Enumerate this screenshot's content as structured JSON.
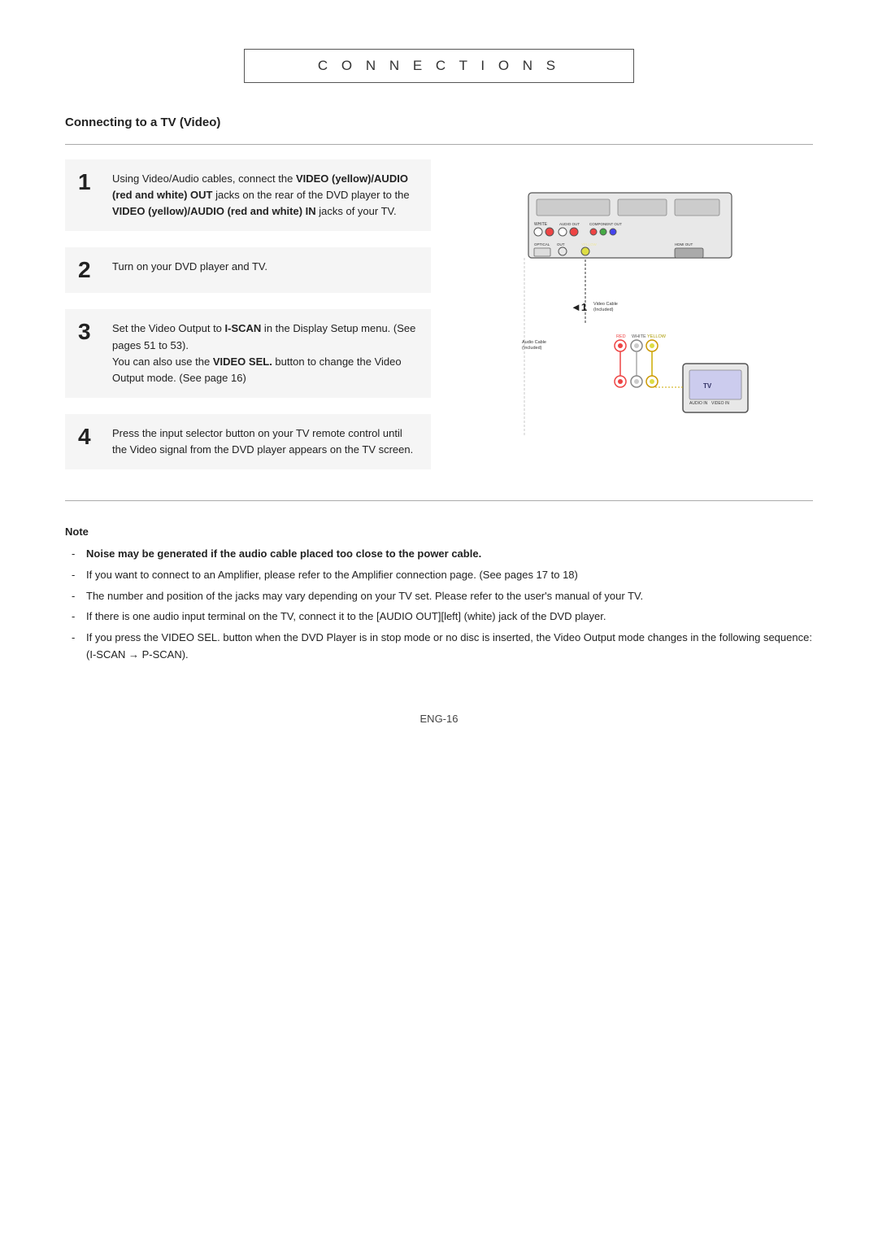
{
  "page": {
    "title": "C O N N E C T I O N S",
    "section_title": "Connecting to a TV (Video)",
    "steps": [
      {
        "number": "1",
        "text_parts": [
          {
            "type": "plain",
            "text": "Using Video/Audio cables, connect the "
          },
          {
            "type": "bold",
            "text": "VIDEO (yellow)/AUDIO (red and white) OUT"
          },
          {
            "type": "plain",
            "text": " jacks on the rear of the DVD player to the "
          },
          {
            "type": "bold",
            "text": "VIDEO (yellow)/AUDIO (red and white) IN"
          },
          {
            "type": "plain",
            "text": " jacks of your TV."
          }
        ]
      },
      {
        "number": "2",
        "text_parts": [
          {
            "type": "plain",
            "text": "Turn on your DVD player and TV."
          }
        ]
      },
      {
        "number": "3",
        "text_parts": [
          {
            "type": "plain",
            "text": "Set the Video Output to "
          },
          {
            "type": "bold",
            "text": "I-SCAN"
          },
          {
            "type": "plain",
            "text": " in the Display Setup menu. (See pages 51 to 53).\nYou can also use the "
          },
          {
            "type": "bold",
            "text": "VIDEO SEL."
          },
          {
            "type": "plain",
            "text": " button to change the Video Output mode. (See page 16)"
          }
        ]
      },
      {
        "number": "4",
        "text_parts": [
          {
            "type": "plain",
            "text": "Press the input selector button on your TV remote control until the Video signal from the DVD player appears on the TV screen."
          }
        ]
      }
    ],
    "note": {
      "title": "Note",
      "items": [
        {
          "bold": true,
          "text": "Noise may be generated if the audio cable placed too close to the power cable."
        },
        {
          "bold": false,
          "text": "If you want to connect to an Amplifier, please refer to the Amplifier connection page. (See pages 17 to 18)"
        },
        {
          "bold": false,
          "text": "The number and position of the jacks may vary depending on your TV set. Please refer to the user's manual of your TV."
        },
        {
          "bold": false,
          "text": "If there is one audio input terminal on the TV, connect it to the [AUDIO OUT][left] (white) jack of the DVD player."
        },
        {
          "bold": false,
          "text": "If you press the VIDEO SEL. button when the DVD Player is in stop mode or no disc is inserted, the Video Output mode changes in the following sequence: (I-SCAN → P-SCAN)."
        }
      ]
    },
    "page_number": "ENG-16"
  }
}
